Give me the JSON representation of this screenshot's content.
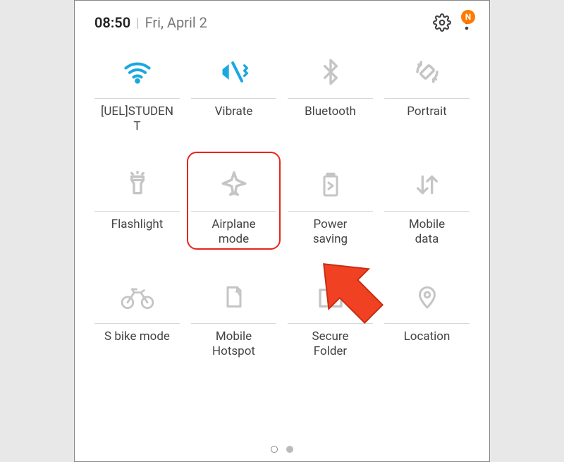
{
  "status": {
    "time": "08:50",
    "separator": "|",
    "date": "Fri, April 2",
    "badge": "N"
  },
  "tiles": [
    {
      "label": "[UEL]STUDEN\nT",
      "active": true
    },
    {
      "label": "Vibrate",
      "active": true
    },
    {
      "label": "Bluetooth",
      "active": false
    },
    {
      "label": "Portrait",
      "active": false
    },
    {
      "label": "Flashlight",
      "active": false
    },
    {
      "label": "Airplane\nmode",
      "active": false,
      "highlight": true
    },
    {
      "label": "Power\nsaving",
      "active": false
    },
    {
      "label": "Mobile\ndata",
      "active": false
    },
    {
      "label": "S bike mode",
      "active": false
    },
    {
      "label": "Mobile\nHotspot",
      "active": false
    },
    {
      "label": "Secure\nFolder",
      "active": false
    },
    {
      "label": "Location",
      "active": false
    }
  ],
  "colors": {
    "active": "#1ba8e0",
    "inactive": "#c5c5c5",
    "highlight": "#e8251b",
    "arrow": "#f04123",
    "badge": "#ff7a00"
  }
}
